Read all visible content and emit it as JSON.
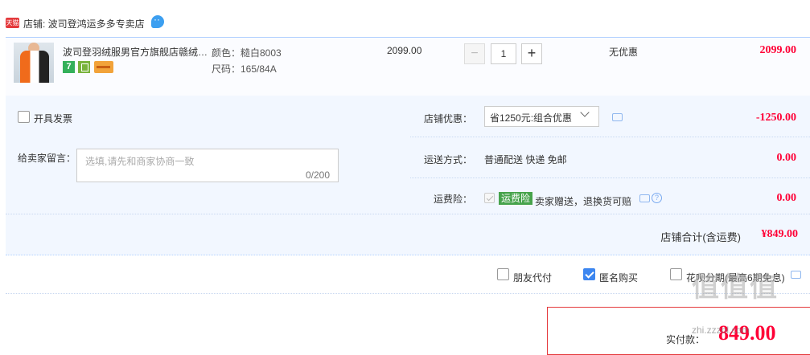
{
  "shop": {
    "badge": "天猫",
    "label": "店铺: 波司登鸿运多多专卖店",
    "chat_icon": "chat-bubble-icon"
  },
  "item": {
    "title": "波司登羽绒服男官方旗舰店赣绒…",
    "sku_color": "颜色：糙白8003",
    "sku_size": "尺码：165/84A",
    "unit_price": "2099.00",
    "quantity": "1",
    "minus": "−",
    "plus": "+",
    "promo": "无优惠",
    "line_total": "2099.00",
    "service_icons": [
      "seven-day-return-icon",
      "box-icon",
      "card-icon"
    ],
    "seven_label": "7"
  },
  "invoice": {
    "label": "开具发票",
    "checked": false
  },
  "memo": {
    "label": "给卖家留言：",
    "placeholder": "选填,请先和商家协商一致",
    "count": "0/200"
  },
  "shop_discount": {
    "label": "店铺优惠：",
    "selected": "省1250元:组合优惠",
    "value": "-1250.00"
  },
  "shipping": {
    "label": "运送方式：",
    "value": "普通配送 快递 免邮",
    "amount": "0.00"
  },
  "insurance": {
    "label": "运费险：",
    "tag": "运费险",
    "desc": "卖家赠送，退换货可赔",
    "amount": "0.00"
  },
  "shop_total": {
    "label": "店铺合计(含运费)",
    "value": "¥849.00"
  },
  "options": {
    "friend_pay": {
      "label": "朋友代付",
      "checked": false
    },
    "anonymous": {
      "label": "匿名购买",
      "checked": true
    },
    "huabei": {
      "label": "花呗分期(最高6期免息)",
      "checked": false
    }
  },
  "payment": {
    "label": "实付款：",
    "amount": "849.00"
  },
  "watermark": {
    "logo": "值值值",
    "url": "zhi.zzzol.com"
  },
  "colors": {
    "price_red": "#ff0036",
    "accent_blue": "#3c86f0",
    "panel_bg": "#f2f7ff",
    "tag_green": "#47a34c"
  }
}
